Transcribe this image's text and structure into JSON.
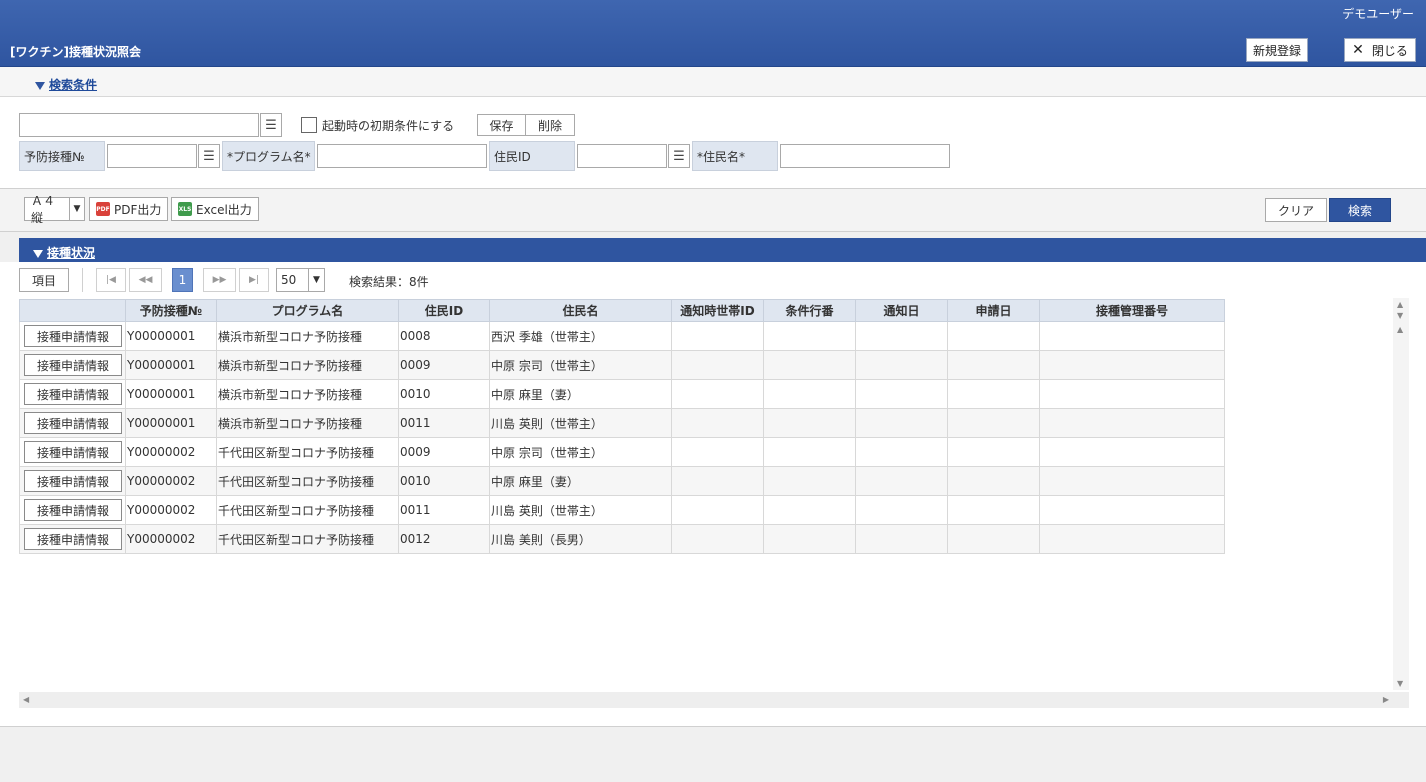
{
  "header": {
    "user": "デモユーザー",
    "title": "[ワクチン]接種状況照会",
    "new_button": "新規登録",
    "close_button": "閉じる"
  },
  "search": {
    "section_title": "検索条件",
    "preset_value": "",
    "startup_checkbox_label": "起動時の初期条件にする",
    "save_label": "保存",
    "delete_label": "削除",
    "fields": {
      "vaccine_no_label": "予防接種№",
      "program_label": "*プログラム名*",
      "resident_id_label": "住民ID",
      "resident_name_label": "*住民名*"
    }
  },
  "toolbar": {
    "paper_size": "Ａ４縦",
    "pdf_label": "PDF出力",
    "excel_label": "Excel出力",
    "clear_label": "クリア",
    "search_label": "検索"
  },
  "results": {
    "section_title": "接種状況",
    "columns_button": "項目",
    "current_page": "1",
    "page_size": "50",
    "result_text": "検索結果：8件",
    "row_button_label": "接種申請情報",
    "headers": [
      "予防接種№",
      "プログラム名",
      "住民ID",
      "住民名",
      "通知時世帯ID",
      "条件行番",
      "通知日",
      "申請日",
      "接種管理番号"
    ],
    "rows": [
      {
        "no": "Y00000001",
        "program": "横浜市新型コロナ予防接種",
        "id": "0008",
        "name": "西沢 季雄（世帯主）"
      },
      {
        "no": "Y00000001",
        "program": "横浜市新型コロナ予防接種",
        "id": "0009",
        "name": "中原 宗司（世帯主）"
      },
      {
        "no": "Y00000001",
        "program": "横浜市新型コロナ予防接種",
        "id": "0010",
        "name": "中原 麻里（妻）"
      },
      {
        "no": "Y00000001",
        "program": "横浜市新型コロナ予防接種",
        "id": "0011",
        "name": "川島 英則（世帯主）"
      },
      {
        "no": "Y00000002",
        "program": "千代田区新型コロナ予防接種",
        "id": "0009",
        "name": "中原 宗司（世帯主）"
      },
      {
        "no": "Y00000002",
        "program": "千代田区新型コロナ予防接種",
        "id": "0010",
        "name": "中原 麻里（妻）"
      },
      {
        "no": "Y00000002",
        "program": "千代田区新型コロナ予防接種",
        "id": "0011",
        "name": "川島 英則（世帯主）"
      },
      {
        "no": "Y00000002",
        "program": "千代田区新型コロナ予防接種",
        "id": "0012",
        "name": "川島 美則（長男）"
      }
    ]
  }
}
